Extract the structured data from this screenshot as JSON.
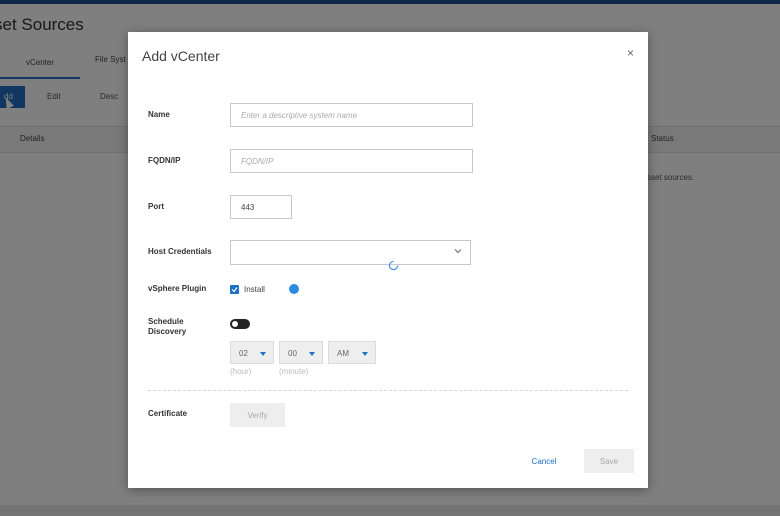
{
  "background": {
    "page_title": "set Sources",
    "tabs": [
      {
        "label": "vCenter"
      },
      {
        "label": "File Syst"
      }
    ],
    "toolbar": {
      "add_label": "dd",
      "edit_label": "Edit",
      "description_label": "Desc"
    },
    "table": {
      "columns": [
        "Details",
        "Status"
      ],
      "empty_text": "sset sources."
    }
  },
  "dialog": {
    "title": "Add vCenter",
    "close_icon": "×",
    "fields": {
      "name": {
        "label": "Name",
        "value": "",
        "placeholder": "Enter a descriptive system name"
      },
      "fqdn": {
        "label": "FQDN/IP",
        "value": "",
        "placeholder": "FQDN/IP"
      },
      "port": {
        "label": "Port",
        "value": "443"
      },
      "host_credentials": {
        "label": "Host Credentials",
        "value": ""
      },
      "vsphere_plugin": {
        "label": "vSphere Plugin",
        "checkbox_label": "Install",
        "checked": true
      },
      "schedule_discovery": {
        "label": "Schedule Discovery",
        "enabled": false,
        "hour": "02",
        "minute": "00",
        "ampm": "AM",
        "hour_hint": "(hour)",
        "minute_hint": "(minute)"
      },
      "certificate": {
        "label": "Certificate",
        "verify_label": "Verify"
      }
    },
    "buttons": {
      "cancel_label": "Cancel",
      "save_label": "Save"
    }
  },
  "colors": {
    "accent": "#1f6fc5",
    "topbar": "#1f4e8c",
    "info": "#2f8be0",
    "toggle_off": "#222222"
  },
  "icons": [
    "close-icon",
    "chevron-down-icon",
    "spinner-icon",
    "check-icon",
    "info-icon",
    "caret-down-icon"
  ]
}
